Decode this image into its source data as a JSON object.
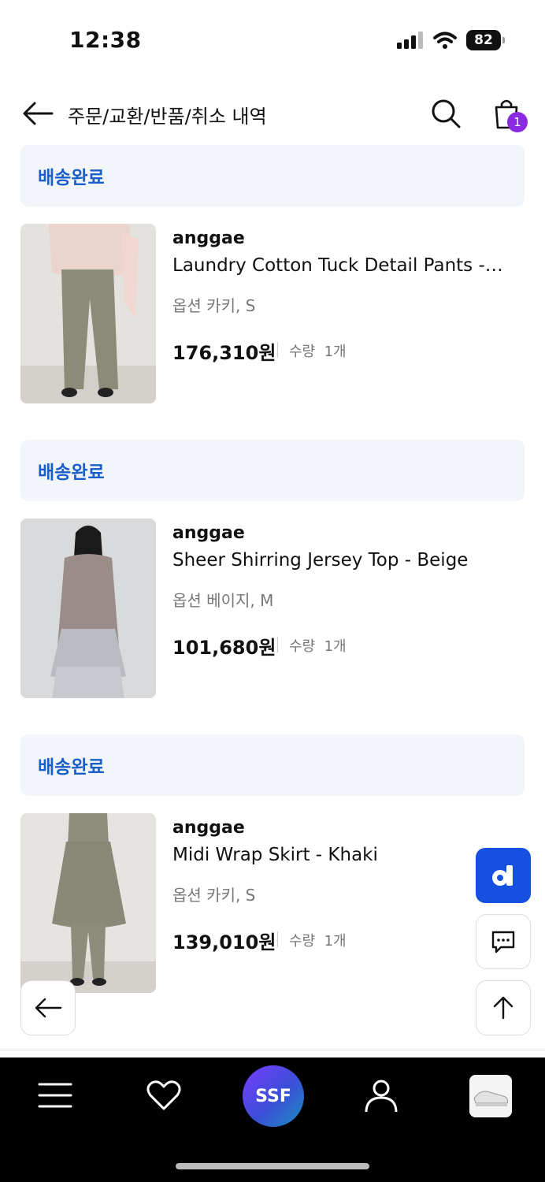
{
  "status_bar": {
    "time": "12:38",
    "battery": "82"
  },
  "header": {
    "title": "주문/교환/반품/취소 내역",
    "cart_count": "1"
  },
  "orders": [
    {
      "status": "배송완료",
      "brand": "anggae",
      "name": "Laundry Cotton Tuck Detail Pants -…",
      "option_label": "옵션",
      "option_value": "카키, S",
      "price": "176,310원",
      "qty_label": "수량",
      "qty_value": "1개"
    },
    {
      "status": "배송완료",
      "brand": "anggae",
      "name": "Sheer Shirring Jersey Top - Beige",
      "option_label": "옵션",
      "option_value": "베이지, M",
      "price": "101,680원",
      "qty_label": "수량",
      "qty_value": "1개"
    },
    {
      "status": "배송완료",
      "brand": "anggae",
      "name": "Midi Wrap Skirt - Khaki",
      "option_label": "옵션",
      "option_value": "카키, S",
      "price": "139,010원",
      "qty_label": "수량",
      "qty_value": "1개"
    }
  ],
  "bottom_nav": {
    "center_label": "SSF"
  },
  "colors": {
    "status_blue": "#1a5fc9",
    "banner_bg": "#f2f5f9",
    "float_blue": "#1650e0",
    "badge": "#8a2be2"
  }
}
